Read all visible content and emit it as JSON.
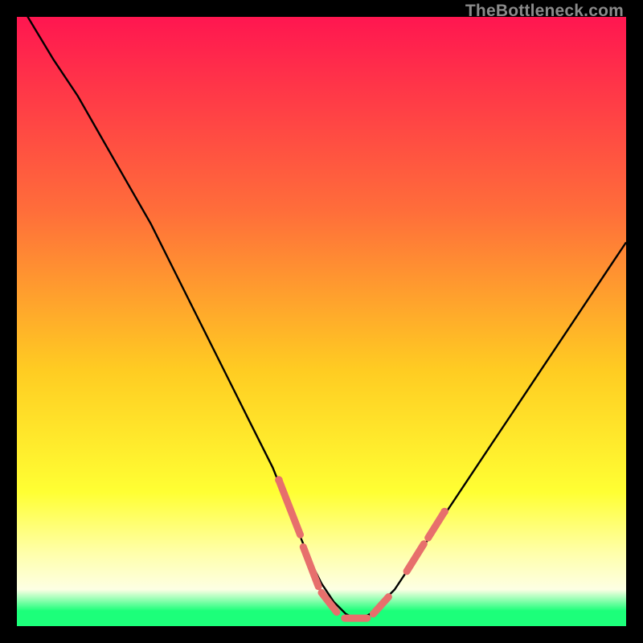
{
  "watermark": "TheBottleneck.com",
  "colors": {
    "gradient_top": "#ff1650",
    "gradient_mid1": "#ff6e3a",
    "gradient_mid2": "#ffcc22",
    "gradient_mid3": "#ffff33",
    "gradient_mid4": "#ffffaa",
    "gradient_bottom_light": "#fdffe4",
    "gradient_green": "#1cff7a",
    "curve": "#000000",
    "dash": "#e76f6c"
  },
  "chart_data": {
    "type": "line",
    "title": "",
    "xlabel": "",
    "ylabel": "",
    "xlim": [
      0,
      100
    ],
    "ylim": [
      0,
      100
    ],
    "series": [
      {
        "name": "bottleneck-curve",
        "x": [
          0,
          3,
          6,
          10,
          14,
          18,
          22,
          26,
          30,
          34,
          38,
          42,
          46,
          48,
          50,
          52,
          54,
          56,
          58,
          62,
          66,
          70,
          74,
          78,
          82,
          86,
          90,
          94,
          98,
          100
        ],
        "y": [
          103,
          98,
          93,
          87,
          80,
          73,
          66,
          58,
          50,
          42,
          34,
          26,
          16,
          11,
          7,
          4,
          2,
          1,
          2,
          6,
          12,
          18,
          24,
          30,
          36,
          42,
          48,
          54,
          60,
          63
        ]
      }
    ],
    "dash_segments": [
      {
        "from": [
          43,
          24
        ],
        "to": [
          46.5,
          15
        ]
      },
      {
        "from": [
          47,
          13
        ],
        "to": [
          49.5,
          6.5
        ]
      },
      {
        "from": [
          50,
          5.5
        ],
        "to": [
          52.5,
          2.3
        ]
      },
      {
        "from": [
          53.8,
          1.3
        ],
        "to": [
          57.5,
          1.3
        ]
      },
      {
        "from": [
          58.5,
          2
        ],
        "to": [
          61,
          4.8
        ]
      },
      {
        "from": [
          64,
          9
        ],
        "to": [
          66.8,
          13.5
        ]
      },
      {
        "from": [
          67.5,
          14.5
        ],
        "to": [
          70.2,
          18.8
        ]
      }
    ]
  }
}
